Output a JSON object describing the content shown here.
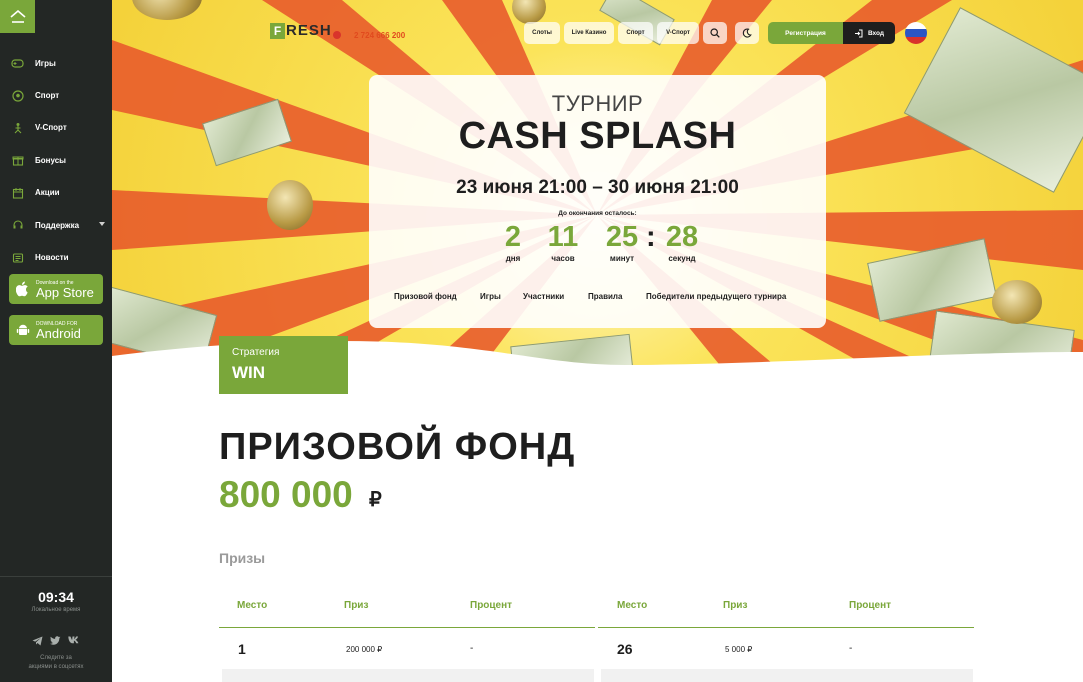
{
  "sidebar": {
    "items": [
      {
        "label": "Игры",
        "icon": "gamepad-icon"
      },
      {
        "label": "Спорт",
        "icon": "soccer-ball-icon"
      },
      {
        "label": "V-Спорт",
        "icon": "virtual-sport-icon"
      },
      {
        "label": "Бонусы",
        "icon": "gift-icon"
      },
      {
        "label": "Акции",
        "icon": "calendar-icon"
      },
      {
        "label": "Поддержка",
        "icon": "support-icon"
      },
      {
        "label": "Новости",
        "icon": "news-icon"
      }
    ],
    "appstore": {
      "small": "Download on the",
      "big": "App Store"
    },
    "android": {
      "small": "DOWNLOAD FOR",
      "big": "Android"
    },
    "time": "09:34",
    "time_label": "Локальное время",
    "social_text_1": "Следите за",
    "social_text_2": "акциями в соцсетях"
  },
  "header": {
    "brand": "RESH",
    "brand_letter": "F",
    "phone": "2 724 666 200",
    "nav": [
      "Слоты",
      "Live Казино",
      "Спорт",
      "V-Спорт"
    ],
    "register": "Регистрация",
    "login": "Вход"
  },
  "tournament": {
    "subtitle": "ТУРНИР",
    "title": "CASH SPLASH",
    "dates": "23 июня 21:00 – 30 июня 21:00",
    "remaining_label": "До окончания осталось:",
    "countdown": [
      {
        "value": "2",
        "unit": "дня"
      },
      {
        "value": "11",
        "unit": "часов"
      },
      {
        "value": "25",
        "unit": "минут"
      },
      {
        "value": "28",
        "unit": "секунд"
      }
    ],
    "colon": ":",
    "tabs": [
      "Призовой фонд",
      "Игры",
      "Участники",
      "Правила",
      "Победители предыдущего турнира"
    ]
  },
  "strategy": {
    "label": "Стратегия",
    "value": "WIN"
  },
  "prize": {
    "title": "ПРИЗОВОЙ ФОНД",
    "amount": "800 000",
    "currency": "₽",
    "prizes_label": "Призы",
    "columns": [
      "Место",
      "Приз",
      "Процент"
    ],
    "left_rows": [
      {
        "place": "1",
        "prize": "200 000 ₽",
        "percent": "-"
      }
    ],
    "right_rows": [
      {
        "place": "26",
        "prize": "5 000 ₽",
        "percent": "-"
      }
    ]
  },
  "colors": {
    "accent": "#7aa73a",
    "sidebar": "#232725",
    "hero_yellow": "#f4d23a",
    "ray_orange": "#e8552a"
  }
}
